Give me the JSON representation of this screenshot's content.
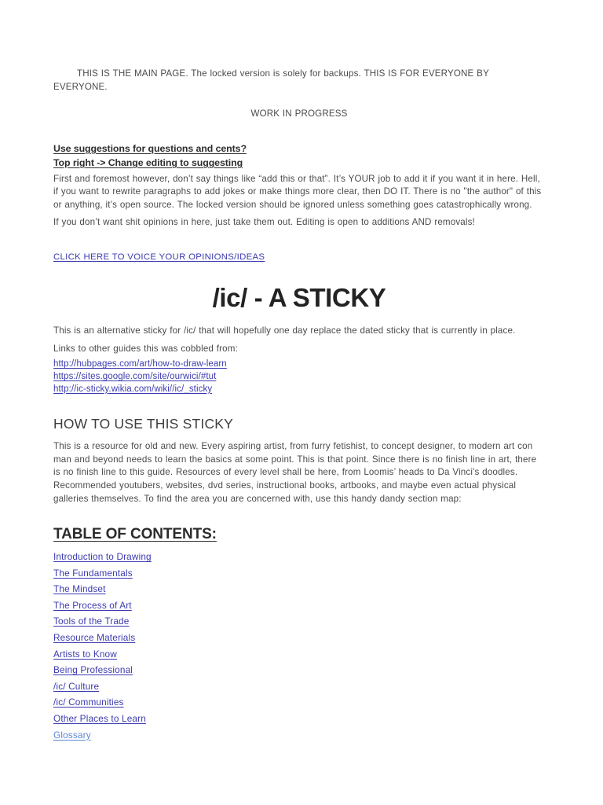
{
  "document": {
    "title": "/ic/ - A STICKY"
  },
  "colors": {
    "link": "#3b3bb0",
    "link_light": "#5a86d8",
    "body_text": "#4a4a4a",
    "heading_text": "#2b2b2b",
    "background": "#ffffff"
  },
  "intro": {
    "notice": "THIS IS THE MAIN PAGE. The locked version is solely for backups. THIS IS FOR EVERYONE BY EVERYONE.",
    "status": "WORK IN PROGRESS"
  },
  "editing": {
    "heading_1": "Use suggestions for questions and cents?",
    "heading_2": "Top right -> Change editing to suggesting ",
    "paragraph_1": "First and foremost however, don’t say things like “add this or that”. It’s YOUR job to add it if you want it in here. Hell, if you want to rewrite paragraphs to add jokes or make things more clear, then DO IT. There is no \"the author\" of this or anything, it’s open source. The locked version should be ignored unless something goes catastrophically wrong.",
    "paragraph_2": "If you don’t want shit opinions in here, just take them out. Editing is open to additions AND removals!",
    "opinions_link": "CLICK HERE TO VOICE YOUR OPINIONS/IDEAS"
  },
  "title_block": {
    "main_title": "/ic/ - A STICKY",
    "subtitle": "This is an alternative sticky for /ic/ that will hopefully one day replace the dated sticky that is currently in place.",
    "links_intro": "Links to other guides this was cobbled from:",
    "source_links": [
      "http://hubpages.com/art/how-to-draw-learn",
      "https://sites.google.com/site/ourwici/#tut",
      "http://ic-sticky.wikia.com/wiki//ic/_sticky"
    ]
  },
  "how_to_use": {
    "heading": "HOW TO USE THIS STICKY",
    "paragraph": "This is a resource for old and new. Every aspiring artist, from furry fetishist, to concept designer, to modern art con man and beyond needs to learn the basics at some point. This is that point. Since there is no finish line in art, there is no finish line to this guide. Resources of every level shall be here, from Loomis’ heads to Da Vinci's doodles. Recommended youtubers, websites, dvd series, instructional books, artbooks, and maybe even actual physical galleries themselves. To find the area you are concerned with, use this handy dandy section map:"
  },
  "table_of_contents": {
    "heading": "TABLE OF CONTENTS:",
    "items": [
      {
        "label": "Introduction to Drawing",
        "style": "normal"
      },
      {
        "label": "The Fundamentals",
        "style": "normal"
      },
      {
        "label": "The Mindset",
        "style": "normal"
      },
      {
        "label": "The Process of Art",
        "style": "normal"
      },
      {
        "label": "Tools of the Trade",
        "style": "normal"
      },
      {
        "label": "Resource Materials",
        "style": "normal"
      },
      {
        "label": "Artists to Know",
        "style": "normal"
      },
      {
        "label": "Being Professional",
        "style": "normal"
      },
      {
        "label": "/ic/ Culture",
        "style": "normal"
      },
      {
        "label": "/ic/ Communities",
        "style": "normal"
      },
      {
        "label": "Other Places to Learn ",
        "style": "normal"
      },
      {
        "label": "Glossary",
        "style": "light"
      }
    ]
  }
}
